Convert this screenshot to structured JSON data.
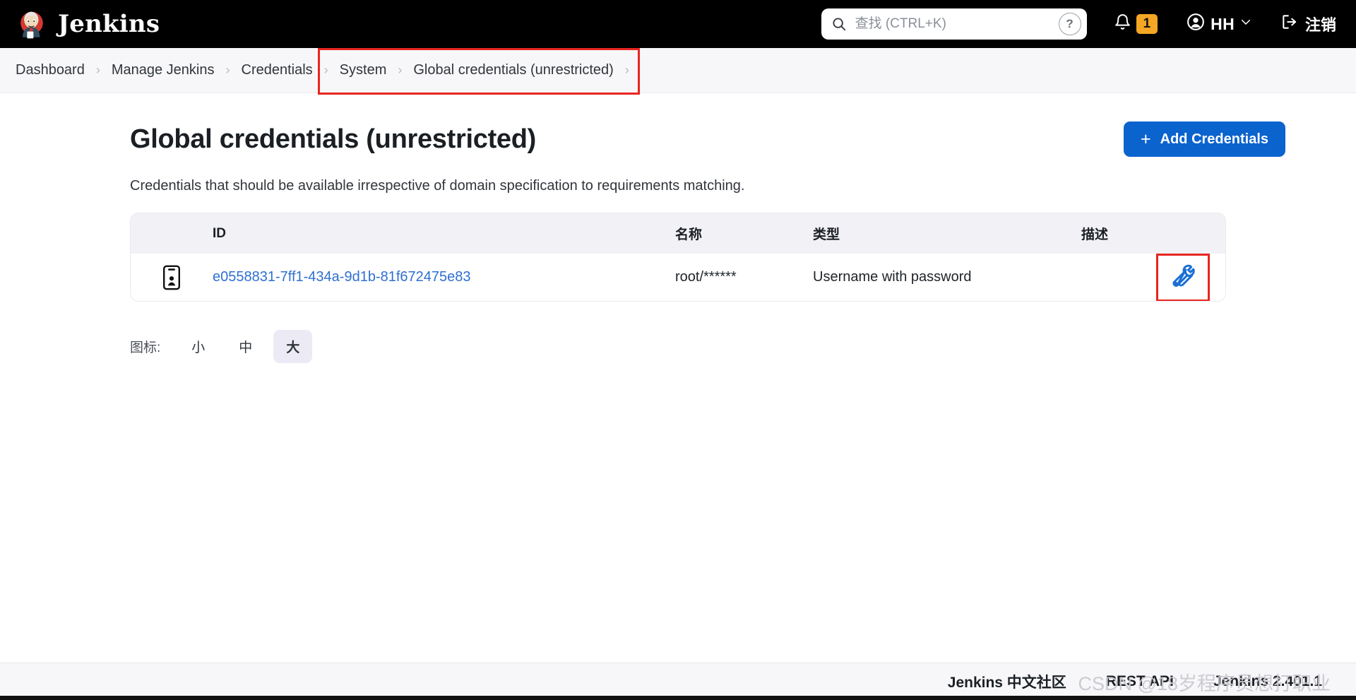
{
  "header": {
    "brand_name": "Jenkins",
    "logo_icon": "jenkins-butler-logo",
    "search": {
      "icon": "search-icon",
      "placeholder": "查找 (CTRL+K)",
      "value": "",
      "help_icon": "question-mark-icon",
      "help_label": "?"
    },
    "notifications": {
      "icon": "bell-icon",
      "count": "1",
      "badge_color": "#f5a623"
    },
    "user": {
      "icon": "account-circle-icon",
      "name": "HH",
      "chevron": "chevron-down-icon"
    },
    "logout": {
      "icon": "logout-icon",
      "label": "注销"
    }
  },
  "breadcrumb": {
    "items": [
      {
        "label": "Dashboard"
      },
      {
        "label": "Manage Jenkins"
      },
      {
        "label": "Credentials"
      },
      {
        "label": "System"
      },
      {
        "label": "Global credentials (unrestricted)"
      }
    ],
    "separator": "›",
    "highlight_color": "#e8251f"
  },
  "main": {
    "title": "Global credentials (unrestricted)",
    "description": "Credentials that should be available irrespective of domain specification to requirements matching.",
    "add_button": {
      "label": "Add Credentials",
      "icon": "plus-icon",
      "color": "#0b63ce"
    },
    "table": {
      "columns": [
        "ID",
        "名称",
        "类型",
        "描述"
      ],
      "rows": [
        {
          "icon": "id-card-icon",
          "id": "e0558831-7ff1-434a-9d1b-81f672475e83",
          "name": "root/******",
          "type": "Username with password",
          "description": "",
          "action_icon": "wrench-icon",
          "action_highlighted": true
        }
      ]
    },
    "icon_size": {
      "label": "图标:",
      "options": [
        "小",
        "中",
        "大"
      ],
      "selected": "大"
    }
  },
  "footer": {
    "links": [
      {
        "label": "Jenkins 中文社区"
      },
      {
        "label": "REST API"
      }
    ],
    "version": "Jenkins 2.401.1",
    "watermark": "CSDN @18岁程序员想打职业"
  }
}
